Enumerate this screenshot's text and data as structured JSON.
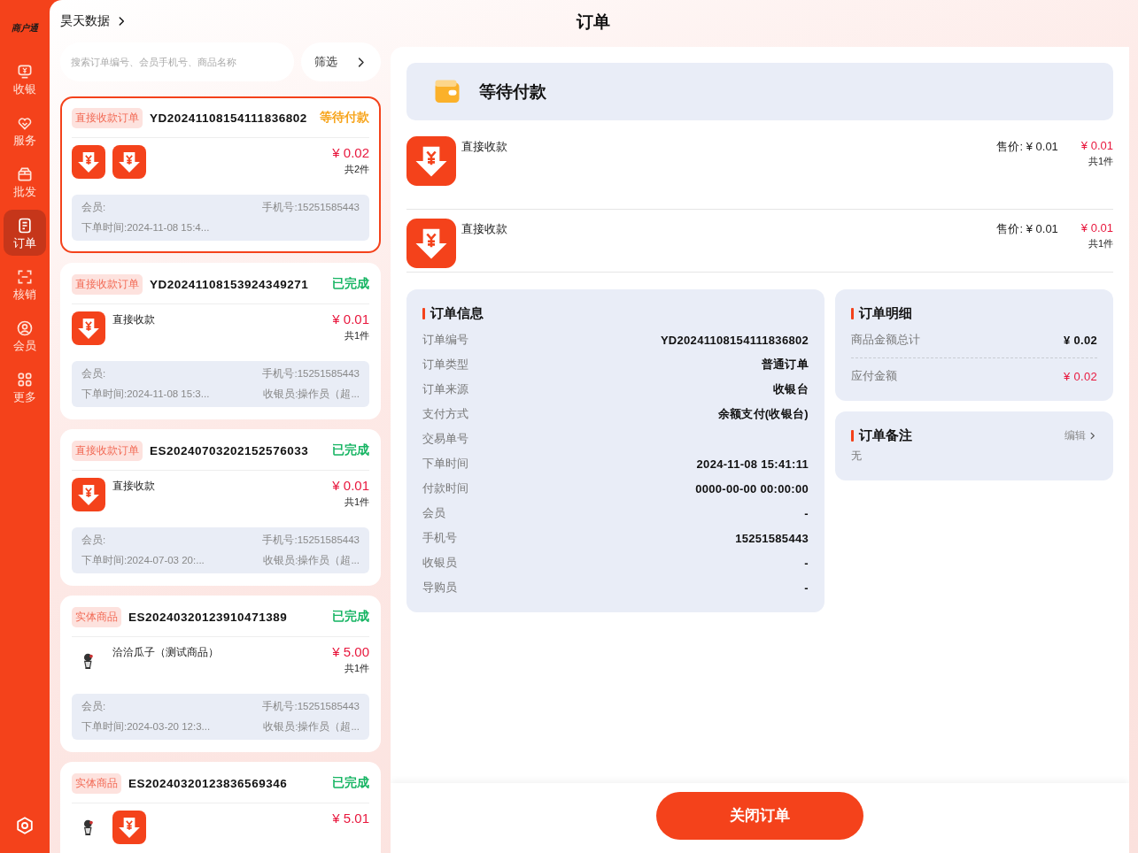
{
  "sidebar": {
    "logo": "商户通",
    "items": [
      {
        "label": "收银",
        "selected": false
      },
      {
        "label": "服务",
        "selected": false
      },
      {
        "label": "批发",
        "selected": false
      },
      {
        "label": "订单",
        "selected": true
      },
      {
        "label": "核销",
        "selected": false
      },
      {
        "label": "会员",
        "selected": false
      },
      {
        "label": "更多",
        "selected": false
      }
    ]
  },
  "breadcrumb": "昊天数据",
  "page_title": "订单",
  "search": {
    "placeholder": "搜索订单编号、会员手机号、商品名称"
  },
  "filter_button": "筛选",
  "orders": [
    {
      "tag": "直接收款订单",
      "number": "YD20241108154111836802",
      "status": {
        "text": "等待付款",
        "color": "#f7a51d"
      },
      "selected": true,
      "items": [
        {
          "kind": "payment"
        },
        {
          "kind": "payment"
        }
      ],
      "total": "¥ 0.02",
      "count": "共2件",
      "member": "会员:",
      "phone": "手机号:15251585443",
      "time": "下单时间:2024-11-08 15:4..."
    },
    {
      "tag": "直接收款订单",
      "number": "YD20241108153924349271",
      "status": {
        "text": "已完成",
        "color": "#18b564"
      },
      "selected": false,
      "items": [
        {
          "kind": "payment",
          "name": "直接收款"
        }
      ],
      "total": "¥ 0.01",
      "count": "共1件",
      "member": "会员:",
      "phone": "手机号:15251585443",
      "time": "下单时间:2024-11-08 15:3...",
      "cashier": "收银员:操作员（超..."
    },
    {
      "tag": "直接收款订单",
      "number": "ES20240703202152576033",
      "status": {
        "text": "已完成",
        "color": "#18b564"
      },
      "selected": false,
      "items": [
        {
          "kind": "payment",
          "name": "直接收款"
        }
      ],
      "total": "¥ 0.01",
      "count": "共1件",
      "member": "会员:",
      "phone": "手机号:15251585443",
      "time": "下单时间:2024-07-03 20:...",
      "cashier": "收银员:操作员（超..."
    },
    {
      "tag": "实体商品",
      "number": "ES20240320123910471389",
      "status": {
        "text": "已完成",
        "color": "#18b564"
      },
      "selected": false,
      "items": [
        {
          "kind": "picture",
          "name": "洽洽瓜子（测试商品）"
        }
      ],
      "total": "¥ 5.00",
      "count": "共1件",
      "member": "会员:",
      "phone": "手机号:15251585443",
      "time": "下单时间:2024-03-20 12:3...",
      "cashier": "收银员:操作员（超..."
    },
    {
      "tag": "实体商品",
      "number": "ES20240320123836569346",
      "status": {
        "text": "已完成",
        "color": "#18b564"
      },
      "selected": false,
      "items": [
        {
          "kind": "picture"
        },
        {
          "kind": "payment"
        }
      ],
      "total": "¥ 5.01"
    }
  ],
  "detail": {
    "status": "等待付款",
    "lines": [
      {
        "name": "直接收款",
        "price": "售价: ¥ 0.01",
        "amount": "¥ 0.01",
        "count": "共1件"
      },
      {
        "name": "直接收款",
        "price": "售价: ¥ 0.01",
        "amount": "¥ 0.01",
        "count": "共1件"
      }
    ],
    "info": {
      "title": "订单信息",
      "rows": [
        {
          "label": "订单编号",
          "value": "YD20241108154111836802"
        },
        {
          "label": "订单类型",
          "value": "普通订单"
        },
        {
          "label": "订单来源",
          "value": "收银台"
        },
        {
          "label": "支付方式",
          "value": "余额支付(收银台)"
        },
        {
          "label": "交易单号"
        },
        {
          "label": "下单时间",
          "value": "2024-11-08 15:41:11"
        },
        {
          "label": "付款时间",
          "value": "0000-00-00 00:00:00"
        },
        {
          "label": "会员",
          "value": "-"
        },
        {
          "label": "手机号",
          "value": "15251585443"
        },
        {
          "label": "收银员",
          "value": "-"
        },
        {
          "label": "导购员",
          "value": "-"
        }
      ]
    },
    "summary": {
      "title": "订单明细",
      "rows": [
        {
          "label": "商品金额总计",
          "value": "¥ 0.02",
          "highlight": false
        },
        {
          "label": "应付金额",
          "value": "¥ 0.02",
          "highlight": true
        }
      ]
    },
    "remark": {
      "title": "订单备注",
      "edit": "编辑",
      "text": "无"
    },
    "close_button": "关闭订单"
  }
}
